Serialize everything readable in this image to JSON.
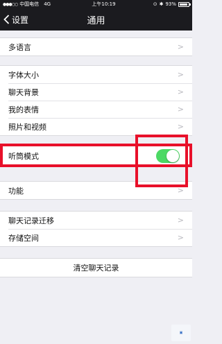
{
  "status_bar": {
    "carrier": "中国电信",
    "network": "4G",
    "time": "上午10:19",
    "battery": "93%",
    "battery_level": 0.93
  },
  "nav": {
    "back_label": "设置",
    "title": "通用"
  },
  "groups": {
    "language": {
      "label": "多语言"
    },
    "display": {
      "items": [
        {
          "label": "字体大小"
        },
        {
          "label": "聊天背景"
        },
        {
          "label": "我的表情"
        },
        {
          "label": "照片和视频"
        }
      ]
    },
    "earpiece": {
      "label": "听筒模式",
      "enabled": true
    },
    "features": {
      "label": "功能"
    },
    "storage": {
      "items": [
        {
          "label": "聊天记录迁移"
        },
        {
          "label": "存储空间"
        }
      ]
    }
  },
  "clear_chat_label": "清空聊天记录",
  "colors": {
    "toggle_on": "#4cd964",
    "highlight": "#e8102a",
    "nav_bg": "#1b1b1f"
  }
}
